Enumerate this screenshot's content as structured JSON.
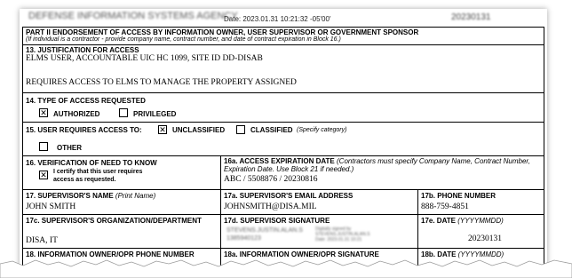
{
  "header": {
    "blurred_title": "DEFENSE INFORMATION SYSTEMS AGENCY",
    "date_stamp": "Date: 2023.01.31 10:21:32 -05'00'",
    "right_blur": "20230131"
  },
  "part2": {
    "title": "PART II ENDORSEMENT OF ACCESS BY INFORMATION OWNER, USER SUPERVISOR OR GOVERNMENT SPONSOR",
    "note": "(If individual is a contractor - provide company name, contract number, and date of contract expiration in Block 16.)"
  },
  "block13": {
    "label": "13. JUSTIFICATION FOR ACCESS",
    "line1": "ELMS USER, ACCOUNTABLE UIC HC 1099, SITE ID DD-DISAB",
    "line2": "REQUIRES ACCESS TO ELMS TO MANAGE THE PROPERTY ASSIGNED"
  },
  "block14": {
    "label": "14. TYPE OF ACCESS REQUESTED",
    "authorized_label": "AUTHORIZED",
    "authorized_checked": true,
    "privileged_label": "PRIVILEGED",
    "privileged_checked": false
  },
  "block15": {
    "label": "15. USER REQUIRES ACCESS TO:",
    "unclassified_label": "UNCLASSIFIED",
    "unclassified_checked": true,
    "classified_label": "CLASSIFIED",
    "classified_note": "(Specify category)",
    "classified_checked": false,
    "other_label": "OTHER",
    "other_checked": false
  },
  "block16": {
    "label": "16. VERIFICATION OF NEED TO KNOW",
    "certify_line1": "I certify that this user requires",
    "certify_line2": "access as requested.",
    "checked": true
  },
  "block16a": {
    "label": "16a. ACCESS EXPIRATION DATE",
    "note_line1": "(Contractors must specify Company Name, Contract Number,",
    "note_line2": "Expiration Date. Use Block 21 if needed.)",
    "value": "ABC / 5508876 / 20230816"
  },
  "block17": {
    "label": "17. SUPERVISOR'S NAME",
    "label_note": "(Print Name)",
    "value": "JOHN SMITH"
  },
  "block17a": {
    "label": "17a. SUPERVISOR'S EMAIL ADDRESS",
    "value": "JOHNSMITH@DISA.MIL"
  },
  "block17b": {
    "label": "17b. PHONE NUMBER",
    "value": "888-759-4851"
  },
  "block17c": {
    "label": "17c. SUPERVISOR'S ORGANIZATION/DEPARTMENT",
    "value": "DISA, IT"
  },
  "block17d": {
    "label": "17d. SUPERVISOR SIGNATURE",
    "sig_line1": "STEVENS.JUSTIN.ALAN.S",
    "sig_line2": "1385940123",
    "sig_side1": "Digitally signed by",
    "sig_side2": "STEVENS.JUSTIN.ALAN.S",
    "sig_side3": "Date: 2023.01.31 10:21"
  },
  "block17e": {
    "label": "17e. DATE",
    "label_note": "(YYYYMMDD)",
    "value": "20230131"
  },
  "block18": {
    "label": "18. INFORMATION OWNER/OPR PHONE NUMBER"
  },
  "block18a": {
    "label": "18a. INFORMATION OWNER/OPR SIGNATURE"
  },
  "block18b": {
    "label": "18b. DATE",
    "label_note": "(YYYYMMDD)"
  },
  "colors": {
    "border": "#000000",
    "paper": "#ffffff",
    "shadow": "#888888"
  }
}
